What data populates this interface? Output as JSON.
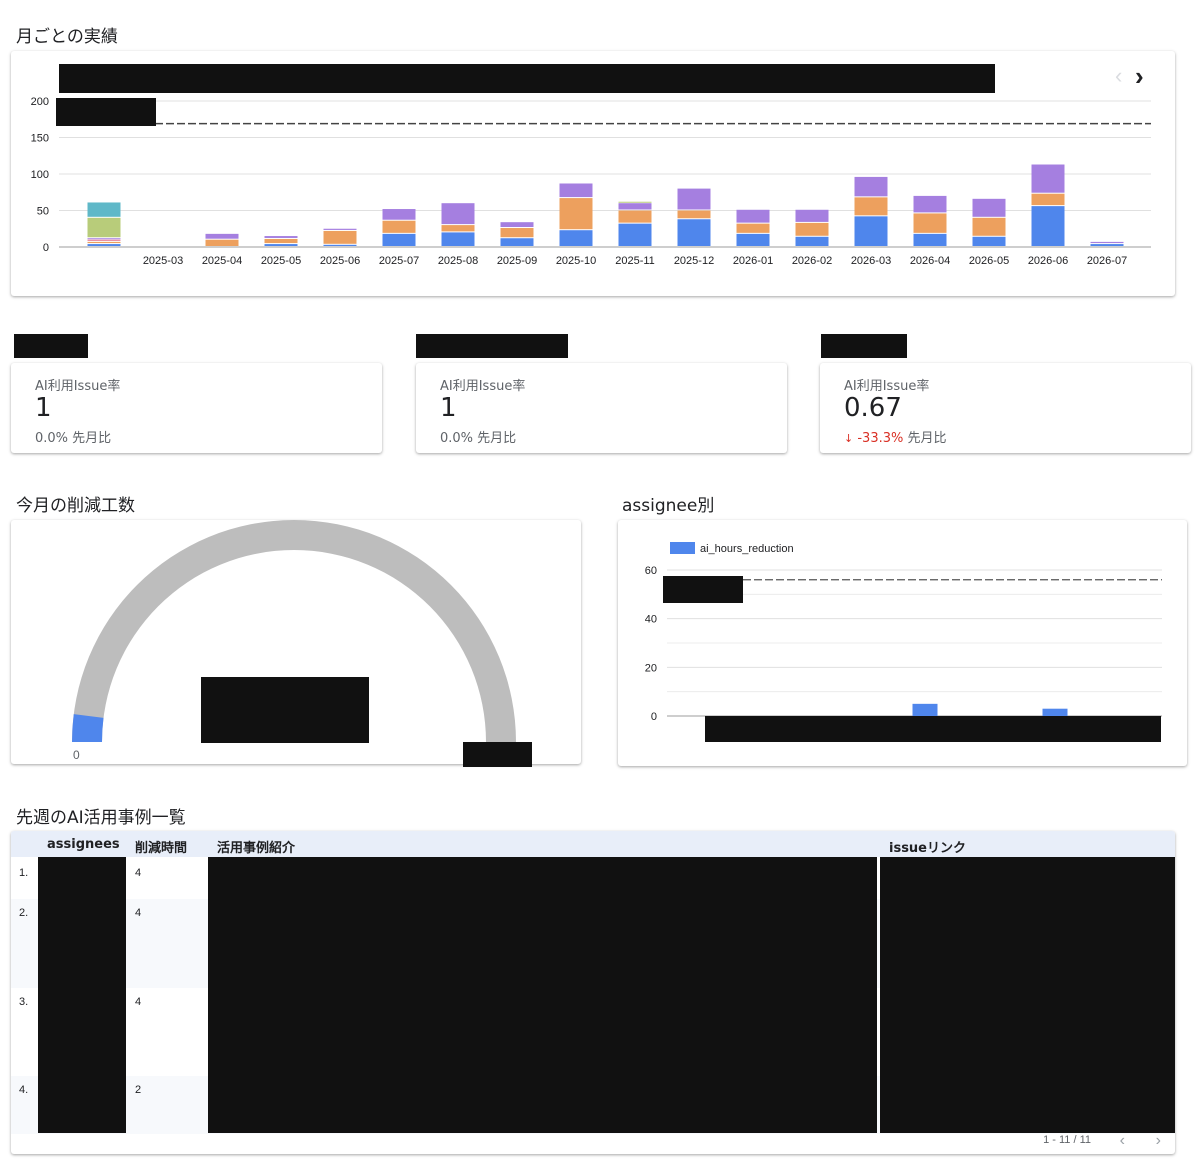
{
  "sections": {
    "monthly_title": "月ごとの実績",
    "reduction_title": "今月の削減工数",
    "assignee_title": "assignee別",
    "cases_title": "先週のAI活用事例一覧"
  },
  "colors": {
    "blue": "#4f86ec",
    "orange": "#eda05e",
    "purple": "#a57fe0",
    "green": "#b8cc7a",
    "teal": "#5fb8c8",
    "pink": "#e8839b",
    "gauge_track": "#bdbdbd",
    "negative": "#d93025"
  },
  "chart_data": [
    {
      "type": "bar",
      "stacked": true,
      "title": "",
      "ylim": [
        0,
        200
      ],
      "yticks": [
        0,
        50,
        100,
        150,
        200
      ],
      "categories": [
        "",
        "2025-03",
        "2025-04",
        "2025-05",
        "2025-06",
        "2025-07",
        "2025-08",
        "2025-09",
        "2025-10",
        "2025-11",
        "2025-12",
        "2026-01",
        "2026-02",
        "2026-03",
        "2026-04",
        "2026-05",
        "2026-06",
        "2026-07"
      ],
      "reference_line": 169,
      "series": [
        {
          "color": "blue",
          "values": [
            4,
            0,
            0,
            4,
            3,
            18,
            20,
            12,
            23,
            32,
            38,
            18,
            14,
            42,
            18,
            14,
            56,
            4
          ]
        },
        {
          "color": "orange",
          "values": [
            3,
            0,
            10,
            7,
            19,
            18,
            10,
            14,
            44,
            18,
            12,
            14,
            19,
            26,
            28,
            26,
            17,
            0
          ]
        },
        {
          "color": "pink",
          "values": [
            3,
            0,
            0,
            0,
            0,
            0,
            0,
            0,
            0,
            0,
            0,
            0,
            0,
            0,
            0,
            0,
            0,
            0
          ]
        },
        {
          "color": "purple",
          "values": [
            2,
            0,
            8,
            4,
            3,
            16,
            30,
            8,
            20,
            10,
            30,
            19,
            18,
            28,
            24,
            26,
            40,
            3
          ]
        },
        {
          "color": "green",
          "values": [
            28,
            0,
            0,
            0,
            0,
            0,
            0,
            0,
            0,
            2,
            0,
            0,
            0,
            0,
            0,
            0,
            0,
            0
          ]
        },
        {
          "color": "teal",
          "values": [
            21,
            0,
            0,
            0,
            0,
            0,
            0,
            0,
            0,
            0,
            0,
            0,
            0,
            0,
            0,
            0,
            0,
            0
          ]
        }
      ]
    },
    {
      "type": "gauge",
      "min_label": "0",
      "value_fraction": 0.04
    },
    {
      "type": "bar",
      "legend": [
        "ai_hours_reduction"
      ],
      "ylim": [
        0,
        60
      ],
      "yticks": [
        0,
        20,
        40,
        60
      ],
      "reference_line": 56,
      "series": [
        {
          "name": "ai_hours_reduction",
          "values": [
            0,
            0,
            0,
            0,
            0,
            0,
            0,
            0
          ]
        }
      ],
      "bars": [
        {
          "slot": 3,
          "value": 5
        },
        {
          "slot": 5,
          "value": 3
        }
      ]
    }
  ],
  "kpis": [
    {
      "label": "AI利用Issue率",
      "value": "1",
      "delta": "0.0%",
      "delta_suffix": "先月比",
      "delta_negative": false
    },
    {
      "label": "AI利用Issue率",
      "value": "1",
      "delta": "0.0%",
      "delta_suffix": "先月比",
      "delta_negative": false
    },
    {
      "label": "AI利用Issue率",
      "value": "0.67",
      "delta": "-33.3%",
      "delta_suffix": "先月比",
      "delta_negative": true,
      "delta_arrow": "↓"
    }
  ],
  "table": {
    "columns": [
      "assignees",
      "削減時間",
      "活用事例紹介",
      "issueリンク"
    ],
    "rows": [
      {
        "index": "1.",
        "hours": "4"
      },
      {
        "index": "2.",
        "hours": "4"
      },
      {
        "index": "3.",
        "hours": "4"
      },
      {
        "index": "4.",
        "hours": "2"
      }
    ],
    "pagination": "1 - 11 / 11",
    "prev_icon": "‹",
    "next_icon": "›"
  },
  "nav": {
    "prev_icon": "‹",
    "next_icon": "›"
  }
}
